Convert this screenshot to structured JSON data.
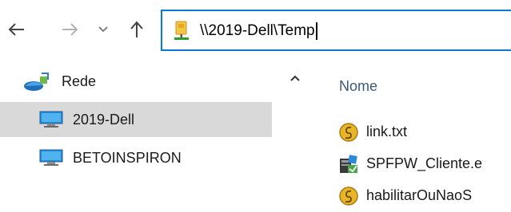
{
  "toolbar": {
    "back_icon": "arrow-left-icon",
    "forward_icon": "arrow-right-icon",
    "recent_icon": "chevron-down-icon",
    "up_icon": "arrow-up-icon",
    "address": {
      "icon": "network-drive-icon",
      "value": "\\\\2019-Dell\\Temp"
    }
  },
  "nav": {
    "items": [
      {
        "label": "Rede",
        "icon": "network-icon",
        "selected": false
      },
      {
        "label": "2019-Dell",
        "icon": "computer-icon",
        "selected": true
      },
      {
        "label": "BETOINSPIRON",
        "icon": "computer-icon",
        "selected": false
      }
    ],
    "collapse_icon": "chevron-up-icon"
  },
  "content": {
    "column_header": "Nome",
    "files": [
      {
        "name": "link.txt",
        "icon": "script-file-icon"
      },
      {
        "name": "SPFPW_Cliente.e",
        "icon": "installer-file-icon"
      },
      {
        "name": "habilitarOuNaoS",
        "icon": "script-file-icon"
      }
    ]
  },
  "colors": {
    "accent": "#0a78d7",
    "selection": "#d9d9d9",
    "header_text": "#3d5a78",
    "drive_green": "#28a028"
  }
}
